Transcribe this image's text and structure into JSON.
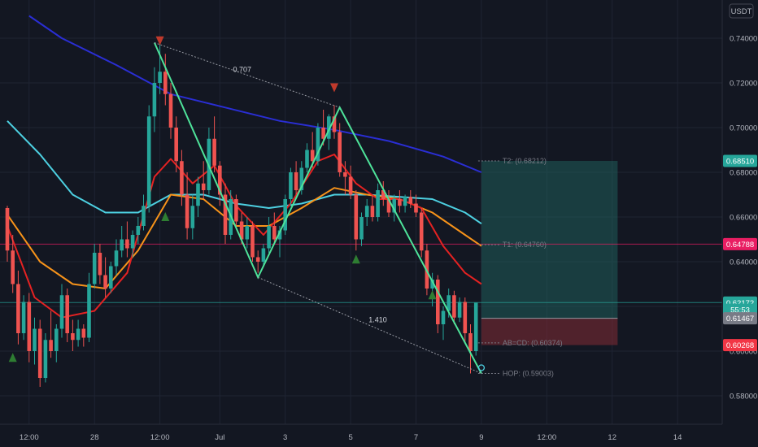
{
  "chart_data": {
    "type": "candlestick",
    "currency": "USDT",
    "y_ticks": [
      0.74,
      0.72,
      0.7,
      0.68,
      0.66,
      0.64,
      0.62,
      0.6,
      0.58
    ],
    "y_tick_labels": [
      "0.74000",
      "0.72000",
      "0.70000",
      "0.68000",
      "0.66000",
      "0.64000",
      "0.62000",
      "0.60000",
      "0.58000"
    ],
    "x_ticks": [
      {
        "i": 4,
        "label": "12:00"
      },
      {
        "i": 16,
        "label": "28"
      },
      {
        "i": 28,
        "label": "12:00"
      },
      {
        "i": 39,
        "label": "Jul"
      },
      {
        "i": 51,
        "label": "3"
      },
      {
        "i": 63,
        "label": "5"
      },
      {
        "i": 75,
        "label": "7"
      },
      {
        "i": 87,
        "label": "9"
      },
      {
        "i": 99,
        "label": "12:00"
      },
      {
        "i": 111,
        "label": "12"
      },
      {
        "i": 123,
        "label": "14"
      }
    ],
    "candles": [
      [
        0.664,
        0.665,
        0.64,
        0.645
      ],
      [
        0.645,
        0.652,
        0.626,
        0.63
      ],
      [
        0.63,
        0.636,
        0.603,
        0.608
      ],
      [
        0.608,
        0.625,
        0.605,
        0.622
      ],
      [
        0.622,
        0.626,
        0.595,
        0.6
      ],
      [
        0.6,
        0.615,
        0.594,
        0.61
      ],
      [
        0.61,
        0.614,
        0.584,
        0.588
      ],
      [
        0.588,
        0.608,
        0.586,
        0.605
      ],
      [
        0.605,
        0.618,
        0.597,
        0.6
      ],
      [
        0.6,
        0.612,
        0.595,
        0.61
      ],
      [
        0.61,
        0.63,
        0.606,
        0.625
      ],
      [
        0.625,
        0.628,
        0.604,
        0.608
      ],
      [
        0.608,
        0.614,
        0.6,
        0.605
      ],
      [
        0.605,
        0.614,
        0.602,
        0.61
      ],
      [
        0.61,
        0.612,
        0.602,
        0.606
      ],
      [
        0.606,
        0.635,
        0.604,
        0.63
      ],
      [
        0.63,
        0.648,
        0.628,
        0.644
      ],
      [
        0.644,
        0.648,
        0.63,
        0.634
      ],
      [
        0.634,
        0.642,
        0.624,
        0.628
      ],
      [
        0.628,
        0.64,
        0.626,
        0.638
      ],
      [
        0.638,
        0.65,
        0.634,
        0.645
      ],
      [
        0.645,
        0.656,
        0.642,
        0.65
      ],
      [
        0.65,
        0.658,
        0.642,
        0.646
      ],
      [
        0.646,
        0.654,
        0.642,
        0.652
      ],
      [
        0.652,
        0.66,
        0.648,
        0.656
      ],
      [
        0.656,
        0.67,
        0.654,
        0.665
      ],
      [
        0.665,
        0.71,
        0.662,
        0.705
      ],
      [
        0.705,
        0.727,
        0.698,
        0.72
      ],
      [
        0.72,
        0.738,
        0.715,
        0.725
      ],
      [
        0.725,
        0.733,
        0.71,
        0.715
      ],
      [
        0.715,
        0.72,
        0.695,
        0.7
      ],
      [
        0.7,
        0.705,
        0.68,
        0.685
      ],
      [
        0.685,
        0.69,
        0.665,
        0.67
      ],
      [
        0.67,
        0.68,
        0.65,
        0.655
      ],
      [
        0.655,
        0.67,
        0.65,
        0.665
      ],
      [
        0.665,
        0.678,
        0.66,
        0.675
      ],
      [
        0.675,
        0.685,
        0.668,
        0.672
      ],
      [
        0.672,
        0.7,
        0.67,
        0.695
      ],
      [
        0.695,
        0.705,
        0.68,
        0.683
      ],
      [
        0.683,
        0.685,
        0.665,
        0.67
      ],
      [
        0.67,
        0.675,
        0.648,
        0.652
      ],
      [
        0.652,
        0.672,
        0.65,
        0.668
      ],
      [
        0.668,
        0.67,
        0.655,
        0.658
      ],
      [
        0.658,
        0.662,
        0.648,
        0.65
      ],
      [
        0.65,
        0.66,
        0.646,
        0.656
      ],
      [
        0.656,
        0.658,
        0.64,
        0.642
      ],
      [
        0.642,
        0.645,
        0.635,
        0.64
      ],
      [
        0.64,
        0.648,
        0.638,
        0.646
      ],
      [
        0.646,
        0.66,
        0.644,
        0.656
      ],
      [
        0.656,
        0.662,
        0.648,
        0.65
      ],
      [
        0.65,
        0.656,
        0.642,
        0.654
      ],
      [
        0.654,
        0.67,
        0.652,
        0.668
      ],
      [
        0.668,
        0.682,
        0.665,
        0.68
      ],
      [
        0.68,
        0.685,
        0.67,
        0.672
      ],
      [
        0.672,
        0.685,
        0.67,
        0.682
      ],
      [
        0.682,
        0.693,
        0.68,
        0.69
      ],
      [
        0.69,
        0.698,
        0.682,
        0.685
      ],
      [
        0.685,
        0.702,
        0.683,
        0.7
      ],
      [
        0.7,
        0.708,
        0.692,
        0.695
      ],
      [
        0.695,
        0.706,
        0.69,
        0.705
      ],
      [
        0.705,
        0.71,
        0.695,
        0.698
      ],
      [
        0.698,
        0.702,
        0.678,
        0.68
      ],
      [
        0.68,
        0.685,
        0.67,
        0.678
      ],
      [
        0.678,
        0.683,
        0.668,
        0.67
      ],
      [
        0.67,
        0.672,
        0.645,
        0.65
      ],
      [
        0.65,
        0.662,
        0.647,
        0.66
      ],
      [
        0.66,
        0.668,
        0.656,
        0.665
      ],
      [
        0.665,
        0.67,
        0.658,
        0.66
      ],
      [
        0.66,
        0.675,
        0.658,
        0.672
      ],
      [
        0.672,
        0.676,
        0.665,
        0.668
      ],
      [
        0.668,
        0.672,
        0.66,
        0.662
      ],
      [
        0.662,
        0.67,
        0.658,
        0.668
      ],
      [
        0.668,
        0.672,
        0.662,
        0.665
      ],
      [
        0.665,
        0.67,
        0.662,
        0.669
      ],
      [
        0.669,
        0.672,
        0.664,
        0.666
      ],
      [
        0.666,
        0.67,
        0.66,
        0.662
      ],
      [
        0.662,
        0.664,
        0.642,
        0.645
      ],
      [
        0.645,
        0.648,
        0.625,
        0.628
      ],
      [
        0.628,
        0.635,
        0.62,
        0.632
      ],
      [
        0.632,
        0.634,
        0.608,
        0.612
      ],
      [
        0.612,
        0.62,
        0.605,
        0.618
      ],
      [
        0.618,
        0.628,
        0.615,
        0.625
      ],
      [
        0.625,
        0.627,
        0.612,
        0.615
      ],
      [
        0.615,
        0.624,
        0.613,
        0.622
      ],
      [
        0.622,
        0.624,
        0.604,
        0.608
      ],
      [
        0.608,
        0.612,
        0.59,
        0.6
      ],
      [
        0.6,
        0.62,
        0.598,
        0.6217
      ]
    ],
    "moving_averages": [
      {
        "color": "#2a2ed4",
        "values": [
          {
            "i": 4,
            "v": 0.75
          },
          {
            "i": 10,
            "v": 0.74
          },
          {
            "i": 20,
            "v": 0.728
          },
          {
            "i": 30,
            "v": 0.715
          },
          {
            "i": 40,
            "v": 0.709
          },
          {
            "i": 50,
            "v": 0.703
          },
          {
            "i": 60,
            "v": 0.699
          },
          {
            "i": 70,
            "v": 0.694
          },
          {
            "i": 80,
            "v": 0.687
          },
          {
            "i": 87,
            "v": 0.68
          }
        ]
      },
      {
        "color": "#4dd0e1",
        "values": [
          {
            "i": 0,
            "v": 0.703
          },
          {
            "i": 6,
            "v": 0.688
          },
          {
            "i": 12,
            "v": 0.67
          },
          {
            "i": 18,
            "v": 0.662
          },
          {
            "i": 24,
            "v": 0.662
          },
          {
            "i": 30,
            "v": 0.67
          },
          {
            "i": 36,
            "v": 0.67
          },
          {
            "i": 42,
            "v": 0.666
          },
          {
            "i": 48,
            "v": 0.664
          },
          {
            "i": 54,
            "v": 0.666
          },
          {
            "i": 60,
            "v": 0.67
          },
          {
            "i": 66,
            "v": 0.67
          },
          {
            "i": 72,
            "v": 0.669
          },
          {
            "i": 78,
            "v": 0.668
          },
          {
            "i": 84,
            "v": 0.662
          },
          {
            "i": 87,
            "v": 0.657
          }
        ]
      },
      {
        "color": "#f7931a",
        "values": [
          {
            "i": 0,
            "v": 0.661
          },
          {
            "i": 6,
            "v": 0.64
          },
          {
            "i": 12,
            "v": 0.63
          },
          {
            "i": 18,
            "v": 0.628
          },
          {
            "i": 24,
            "v": 0.645
          },
          {
            "i": 30,
            "v": 0.67
          },
          {
            "i": 36,
            "v": 0.668
          },
          {
            "i": 42,
            "v": 0.656
          },
          {
            "i": 48,
            "v": 0.656
          },
          {
            "i": 54,
            "v": 0.664
          },
          {
            "i": 60,
            "v": 0.673
          },
          {
            "i": 66,
            "v": 0.67
          },
          {
            "i": 72,
            "v": 0.668
          },
          {
            "i": 78,
            "v": 0.662
          },
          {
            "i": 84,
            "v": 0.652
          },
          {
            "i": 87,
            "v": 0.647
          }
        ]
      },
      {
        "color": "#e52222",
        "values": [
          {
            "i": 0,
            "v": 0.656
          },
          {
            "i": 5,
            "v": 0.624
          },
          {
            "i": 10,
            "v": 0.615
          },
          {
            "i": 16,
            "v": 0.618
          },
          {
            "i": 22,
            "v": 0.635
          },
          {
            "i": 27,
            "v": 0.678
          },
          {
            "i": 30,
            "v": 0.686
          },
          {
            "i": 34,
            "v": 0.675
          },
          {
            "i": 38,
            "v": 0.683
          },
          {
            "i": 42,
            "v": 0.665
          },
          {
            "i": 47,
            "v": 0.652
          },
          {
            "i": 52,
            "v": 0.666
          },
          {
            "i": 57,
            "v": 0.685
          },
          {
            "i": 60,
            "v": 0.688
          },
          {
            "i": 64,
            "v": 0.675
          },
          {
            "i": 68,
            "v": 0.668
          },
          {
            "i": 72,
            "v": 0.668
          },
          {
            "i": 76,
            "v": 0.664
          },
          {
            "i": 80,
            "v": 0.647
          },
          {
            "i": 84,
            "v": 0.635
          },
          {
            "i": 87,
            "v": 0.63
          }
        ]
      }
    ],
    "pattern": {
      "points": [
        {
          "i": 27,
          "v": 0.738
        },
        {
          "i": 46,
          "v": 0.633
        },
        {
          "i": 61,
          "v": 0.709
        },
        {
          "i": 87,
          "v": 0.59
        }
      ],
      "ratio_labels": [
        {
          "text": "0.707"
        },
        {
          "text": "1.410"
        }
      ]
    },
    "levels": [
      {
        "label": "T2: (0.68212)",
        "v": 0.6851
      },
      {
        "label": "T1: (0.64760)",
        "v": 0.6476
      },
      {
        "label": "AB=CD: (0.60374)",
        "v": 0.6037
      },
      {
        "label": "HOP: (0.59003)",
        "v": 0.59
      }
    ],
    "position": {
      "entry": 0.6147,
      "target": 0.6851,
      "stop": 0.6027,
      "i_start": 87,
      "i_end": 112
    },
    "price_tags": [
      {
        "text": "0.68510",
        "v": 0.6851,
        "color": "#26a69a"
      },
      {
        "text": "0.64788",
        "v": 0.64788,
        "color": "#e91e63"
      },
      {
        "text": "0.62172",
        "v": 0.62172,
        "color": "#26a69a"
      },
      {
        "text": "55:53",
        "v": 0.6185,
        "color": "#26a69a"
      },
      {
        "text": "0.61467",
        "v": 0.61467,
        "color": "#787b86"
      },
      {
        "text": "0.60268",
        "v": 0.60268,
        "color": "#f23645"
      }
    ],
    "signals": [
      {
        "i": 1,
        "v": 0.597,
        "dir": "up"
      },
      {
        "i": 29,
        "v": 0.66,
        "dir": "up"
      },
      {
        "i": 28,
        "v": 0.739,
        "dir": "down"
      },
      {
        "i": 60,
        "v": 0.718,
        "dir": "down"
      },
      {
        "i": 64,
        "v": 0.641,
        "dir": "up"
      },
      {
        "i": 78,
        "v": 0.625,
        "dir": "up"
      }
    ],
    "h_lines": [
      {
        "v": 0.64788,
        "color": "#e91e63"
      },
      {
        "v": 0.62172,
        "color": "#26a69a"
      }
    ]
  }
}
